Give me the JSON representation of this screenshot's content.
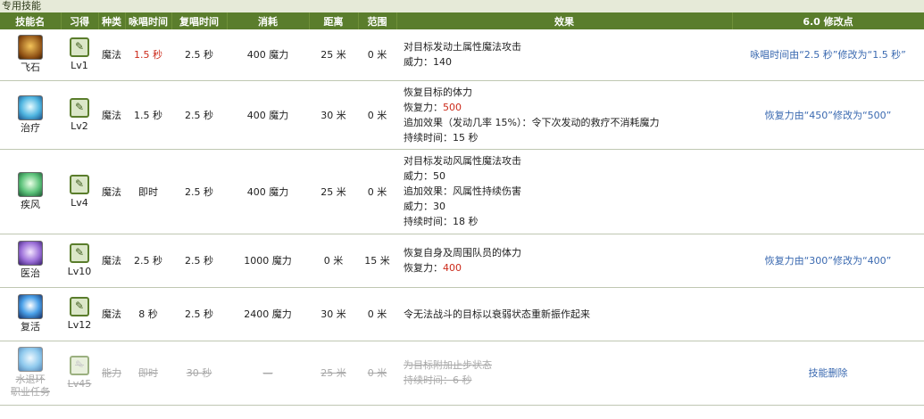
{
  "section_title": "专用技能",
  "headers": [
    "技能名",
    "习得",
    "种类",
    "咏唱时间",
    "复唱时间",
    "消耗",
    "距离",
    "范围",
    "效果",
    "6.0 修改点"
  ],
  "rows": [
    {
      "icon": "stone-icon",
      "name": "飞石",
      "level": "Lv1",
      "type": "魔法",
      "cast": "1.5 秒",
      "recast": "2.5 秒",
      "cost": "400 魔力",
      "distance": "25 米",
      "range": "0 米",
      "effect": [
        "对目标发动土属性魔法攻击",
        "威力：140"
      ],
      "note": "咏唱时间由“2.5 秒”修改为“1.5 秒”"
    },
    {
      "icon": "cure-icon",
      "name": "治疗",
      "level": "Lv2",
      "type": "魔法",
      "cast": "1.5 秒",
      "recast": "2.5 秒",
      "cost": "400 魔力",
      "distance": "30 米",
      "range": "0 米",
      "effect_l1": "恢复目标的体力",
      "effect_l2_label": "恢复力：",
      "effect_l2_value": "500",
      "effect_l3": "追加效果（发动几率 15%）：令下次发动的救疗不消耗魔力",
      "effect_l4": "持续时间：15 秒",
      "note": "恢复力由“450”修改为“500”"
    },
    {
      "icon": "aero-icon",
      "name": "疾风",
      "level": "Lv4",
      "type": "魔法",
      "cast": "即时",
      "recast": "2.5 秒",
      "cost": "400 魔力",
      "distance": "25 米",
      "range": "0 米",
      "effect": [
        "对目标发动风属性魔法攻击",
        "威力：50",
        "追加效果：风属性持续伤害",
        "威力：30",
        "持续时间：18 秒"
      ],
      "note": ""
    },
    {
      "icon": "medica-icon",
      "name": "医治",
      "level": "Lv10",
      "type": "魔法",
      "cast": "2.5 秒",
      "recast": "2.5 秒",
      "cost": "1000 魔力",
      "distance": "0 米",
      "range": "15 米",
      "effect_l1": "恢复自身及周围队员的体力",
      "effect_l2_label": "恢复力：",
      "effect_l2_value": "400",
      "note": "恢复力由“300”修改为“400”"
    },
    {
      "icon": "raise-icon",
      "name": "复活",
      "level": "Lv12",
      "type": "魔法",
      "cast": "8 秒",
      "recast": "2.5 秒",
      "cost": "2400 魔力",
      "distance": "30 米",
      "range": "0 米",
      "effect": [
        "令无法战斗的目标以衰弱状态重新振作起来"
      ],
      "note": ""
    },
    {
      "icon": "protect-icon",
      "name": "水退环",
      "name2": "职业任务",
      "level": "Lv45",
      "type": "能力",
      "cast": "即时",
      "recast": "30 秒",
      "cost": "—",
      "distance": "25 米",
      "range": "0 米",
      "effect": [
        "为目标附加止步状态",
        "持续时间：6 秒"
      ],
      "note": "技能删除"
    }
  ]
}
